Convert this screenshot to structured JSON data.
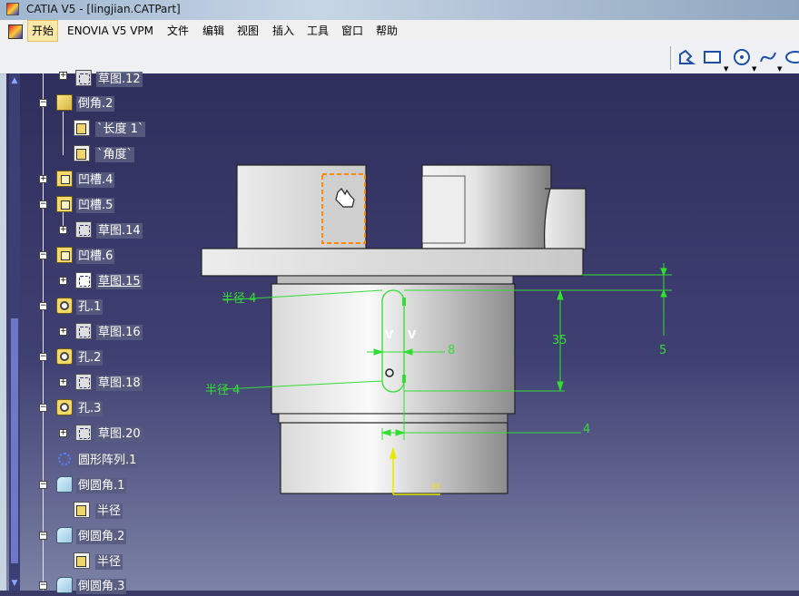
{
  "window": {
    "title": "CATIA V5 - [lingjian.CATPart]"
  },
  "menu": {
    "items": [
      {
        "label": "开始"
      },
      {
        "label": "ENOVIA V5 VPM"
      },
      {
        "label": "文件"
      },
      {
        "label": "编辑"
      },
      {
        "label": "视图"
      },
      {
        "label": "插入"
      },
      {
        "label": "工具"
      },
      {
        "label": "窗口"
      },
      {
        "label": "帮助"
      }
    ]
  },
  "toolbar": {
    "icons": [
      "profile-icon",
      "rectangle-icon",
      "circle-icon",
      "spline-icon",
      "ellipse-icon"
    ]
  },
  "tree": {
    "items": [
      {
        "label": "草图.12"
      },
      {
        "label": "倒角.2"
      },
      {
        "label": "`长度 1`"
      },
      {
        "label": "`角度`"
      },
      {
        "label": "凹槽.4"
      },
      {
        "label": "凹槽.5"
      },
      {
        "label": "草图.14"
      },
      {
        "label": "凹槽.6"
      },
      {
        "label": "草图.15"
      },
      {
        "label": "孔.1"
      },
      {
        "label": "草图.16"
      },
      {
        "label": "孔.2"
      },
      {
        "label": "草图.18"
      },
      {
        "label": "孔.3"
      },
      {
        "label": "草图.20"
      },
      {
        "label": "圆形阵列.1"
      },
      {
        "label": "倒圆角.1"
      },
      {
        "label": "半径"
      },
      {
        "label": "倒圆角.2"
      },
      {
        "label": "半径"
      },
      {
        "label": "倒圆角.3"
      }
    ]
  },
  "dimensions": {
    "radius_top": "半径 4",
    "radius_bottom": "半径 4",
    "width": "8",
    "height": "35",
    "offset_right": "5",
    "offset_bottom": "4",
    "constraint_v": "V",
    "axis_h": "H"
  },
  "colors": {
    "dimension": "#33dd33",
    "highlight": "#ff8800",
    "axis": "#e8e800",
    "background_top": "#2f2f5d"
  }
}
